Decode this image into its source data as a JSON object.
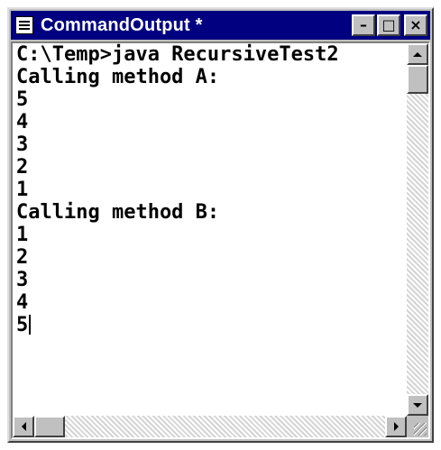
{
  "window": {
    "title": "CommandOutput *",
    "controls": {
      "minimize": "–",
      "maximize": "□",
      "close": "×"
    }
  },
  "output": {
    "lines": [
      "C:\\Temp>java RecursiveTest2",
      "Calling method A:",
      "5",
      "4",
      "3",
      "2",
      "1",
      "Calling method B:",
      "1",
      "2",
      "3",
      "4",
      "5"
    ]
  },
  "icons": {
    "app": "notepad-document-icon",
    "up": "arrow-up-icon",
    "down": "arrow-down-icon",
    "left": "arrow-left-icon",
    "right": "arrow-right-icon"
  }
}
